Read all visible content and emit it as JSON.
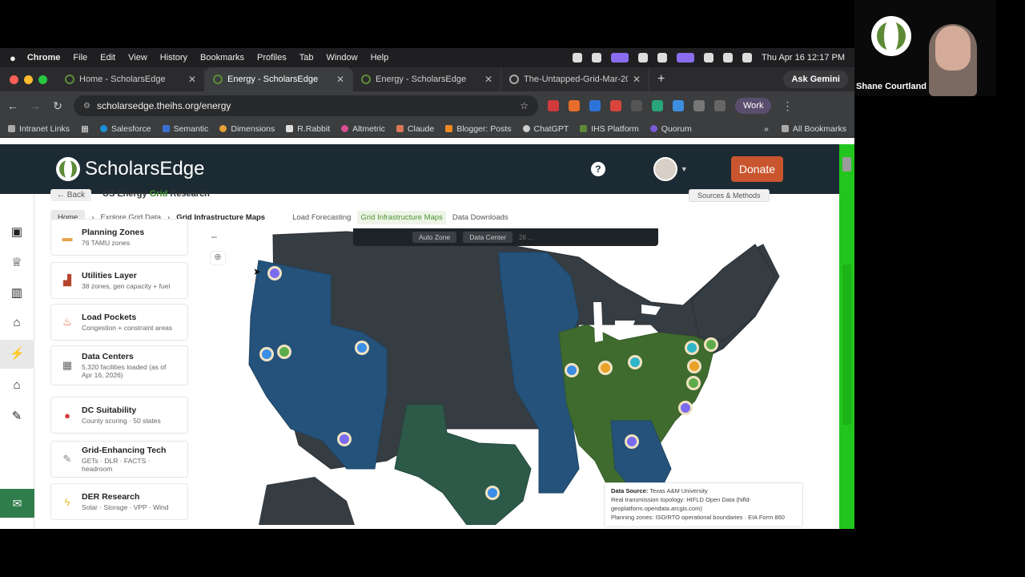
{
  "menubar": {
    "app": "Chrome",
    "items": [
      "File",
      "Edit",
      "View",
      "History",
      "Bookmarks",
      "Profiles",
      "Tab",
      "Window",
      "Help"
    ],
    "clock": "Thu Apr 16  12:17 PM"
  },
  "tabs": [
    {
      "title": "Home - ScholarsEdge",
      "active": false
    },
    {
      "title": "Energy - ScholarsEdge",
      "active": true
    },
    {
      "title": "Energy - ScholarsEdge",
      "active": false
    },
    {
      "title": "The-Untapped-Grid-Mar-202",
      "active": false
    }
  ],
  "gemini_label": "Ask Gemini",
  "address": {
    "url": "scholarsedge.theihs.org/energy",
    "profile": "Work"
  },
  "bookmarks": {
    "items": [
      "Intranet Links",
      "Salesforce",
      "Semantic",
      "Dimensions",
      "R.Rabbit",
      "Altmetric",
      "Claude",
      "Blogger: Posts",
      "ChatGPT",
      "IHS Platform",
      "Quorum"
    ],
    "more": "»",
    "all": "All Bookmarks"
  },
  "site": {
    "logo": "ScholarsEdge",
    "help": "?",
    "donate": "Donate"
  },
  "subhead": {
    "back": "← Back",
    "title_pre": "US Energy ",
    "title_green": "Grid",
    "title_post": " Research",
    "sources": "Sources & Methods"
  },
  "breadcrumbs": {
    "home": "Home",
    "sep": "›",
    "explore": "Explore Grid Data",
    "current": "Grid Infrastructure Maps",
    "tabs": [
      "Load Forecasting",
      "Grid Infrastructure Maps",
      "Data Downloads"
    ],
    "selected_tab": "Grid Infrastructure Maps"
  },
  "layers": [
    {
      "name": "Planning Zones",
      "desc": "76 TAMU zones",
      "icon": "folder-icon",
      "glyph": "▬",
      "color": "#e7a34b"
    },
    {
      "name": "Utilities Layer",
      "desc": "38 zones, gen capacity + fuel",
      "icon": "factory-icon",
      "glyph": "🏭",
      "color": "#b5452c"
    },
    {
      "name": "Load Pockets",
      "desc": "Congestion + constraint areas",
      "icon": "fire-icon",
      "glyph": "🔥",
      "color": "#e0531f"
    },
    {
      "name": "Data Centers",
      "desc": "5,320 facilities loaded (as of Apr 16, 2026)",
      "icon": "server-icon",
      "glyph": "▦",
      "color": "#666"
    },
    {
      "name": "DC Suitability",
      "desc": "County scoring · 50 states",
      "icon": "pin-icon",
      "glyph": "📍",
      "color": "#d23a3a"
    },
    {
      "name": "Grid-Enhancing Tech",
      "desc": "GETs · DLR · FACTS · headroom",
      "icon": "wrench-icon",
      "glyph": "🔧",
      "color": "#888"
    },
    {
      "name": "DER Research",
      "desc": "Solar · Storage · VPP · Wind",
      "icon": "bolt-icon",
      "glyph": "⚡",
      "color": "#e8b824"
    }
  ],
  "map": {
    "zoom_out": "–",
    "toolbar": [
      "Auto Zone",
      "Data Center"
    ],
    "toolbar_count": "26 ...",
    "markers": [
      {
        "color": "#7a6cf0"
      },
      {
        "color": "#3d8ee6"
      },
      {
        "color": "#5dab4a"
      },
      {
        "color": "#3d8ee6"
      },
      {
        "color": "#7a6cf0"
      },
      {
        "color": "#3d8ee6"
      },
      {
        "color": "#e8a227"
      },
      {
        "color": "#2fb5c9"
      },
      {
        "color": "#2fb5c9"
      },
      {
        "color": "#5dab4a"
      },
      {
        "color": "#e8a227"
      },
      {
        "color": "#5dab4a"
      },
      {
        "color": "#7a6cf0"
      },
      {
        "color": "#7a6cf0"
      },
      {
        "color": "#3d8ee6"
      }
    ]
  },
  "datasource": {
    "label": "Data Source:",
    "source": "Texas A&M University",
    "line2": "Real transmission topology: HIFLD Open Data (hifld-",
    "line3": "geoplatform.opendata.arcgis.com)",
    "line4": "Planning zones: ISO/RTO operational boundaries · EIA Form 860"
  },
  "webcam": {
    "name": "Shane Courtland"
  },
  "colors": {
    "accent_green": "#22c51d",
    "header": "#1c2a33",
    "donate": "#c9552e",
    "map_blue": "#25527a",
    "map_green": "#3f6b2f",
    "map_dark": "#353c42"
  }
}
